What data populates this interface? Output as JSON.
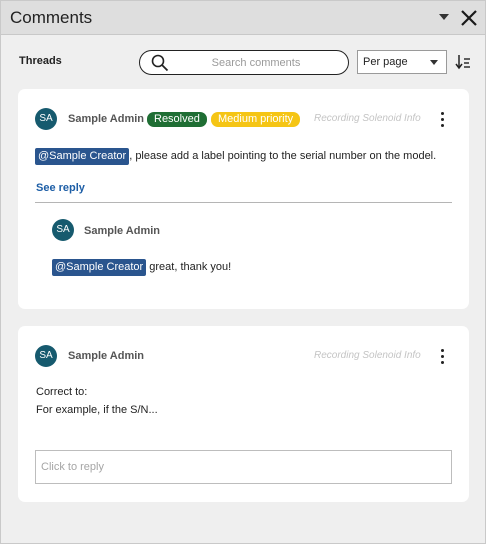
{
  "window": {
    "title": "Comments"
  },
  "toolbar": {
    "threads_label": "Threads",
    "search_placeholder": "Search comments",
    "per_page_label": "Per page"
  },
  "threads": [
    {
      "avatar": "SA",
      "author": "Sample Admin",
      "badges": [
        "Resolved",
        "Medium priority"
      ],
      "context": "Recording Solenoid Info",
      "mention": "@Sample Creator",
      "text": ", please add a label pointing to the serial number on the model.",
      "see_reply": "See reply",
      "reply": {
        "avatar": "SA",
        "author": "Sample Admin",
        "mention": "@Sample Creator",
        "text": " great, thank you!"
      }
    },
    {
      "avatar": "SA",
      "author": "Sample Admin",
      "context": "Recording Solenoid Info",
      "lines": [
        "Correct to:",
        "For example, if the S/N..."
      ],
      "reply_placeholder": "Click to reply"
    }
  ],
  "colors": {
    "avatar": "#165a6e",
    "resolved_badge": "#1f6e34",
    "priority_badge": "#f5c515",
    "mention": "#2a558e",
    "link": "#1d5ea6"
  },
  "icons": [
    "chevron-down-icon",
    "close-icon",
    "search-icon",
    "chevron-down-icon",
    "sort-icon",
    "more-vertical-icon"
  ]
}
